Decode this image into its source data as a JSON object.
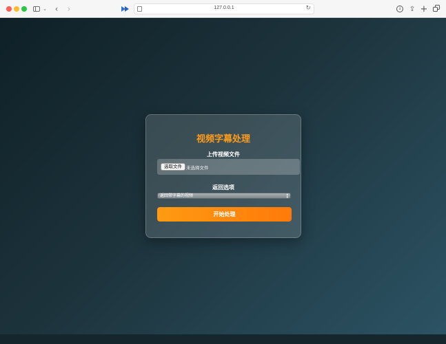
{
  "browser": {
    "url": "127.0.0.1",
    "icons": [
      "sidebar-icon",
      "chevron-down-icon",
      "back-icon",
      "forward-icon",
      "extension-icon",
      "page-icon",
      "reload-icon",
      "download-icon",
      "share-icon",
      "plus-icon",
      "tabs-icon"
    ]
  },
  "form": {
    "title": "视频字幕处理",
    "upload_label": "上传视频文件",
    "choose_button": "选取文件",
    "no_file_text": "未选择文件",
    "option_label": "返回选项",
    "selected_option": "返回带字幕的视频",
    "submit_label": "开始处理"
  },
  "colors": {
    "accent": "#ff9d1a",
    "button_start": "#ff9a12",
    "button_end": "#ff7a0a"
  }
}
